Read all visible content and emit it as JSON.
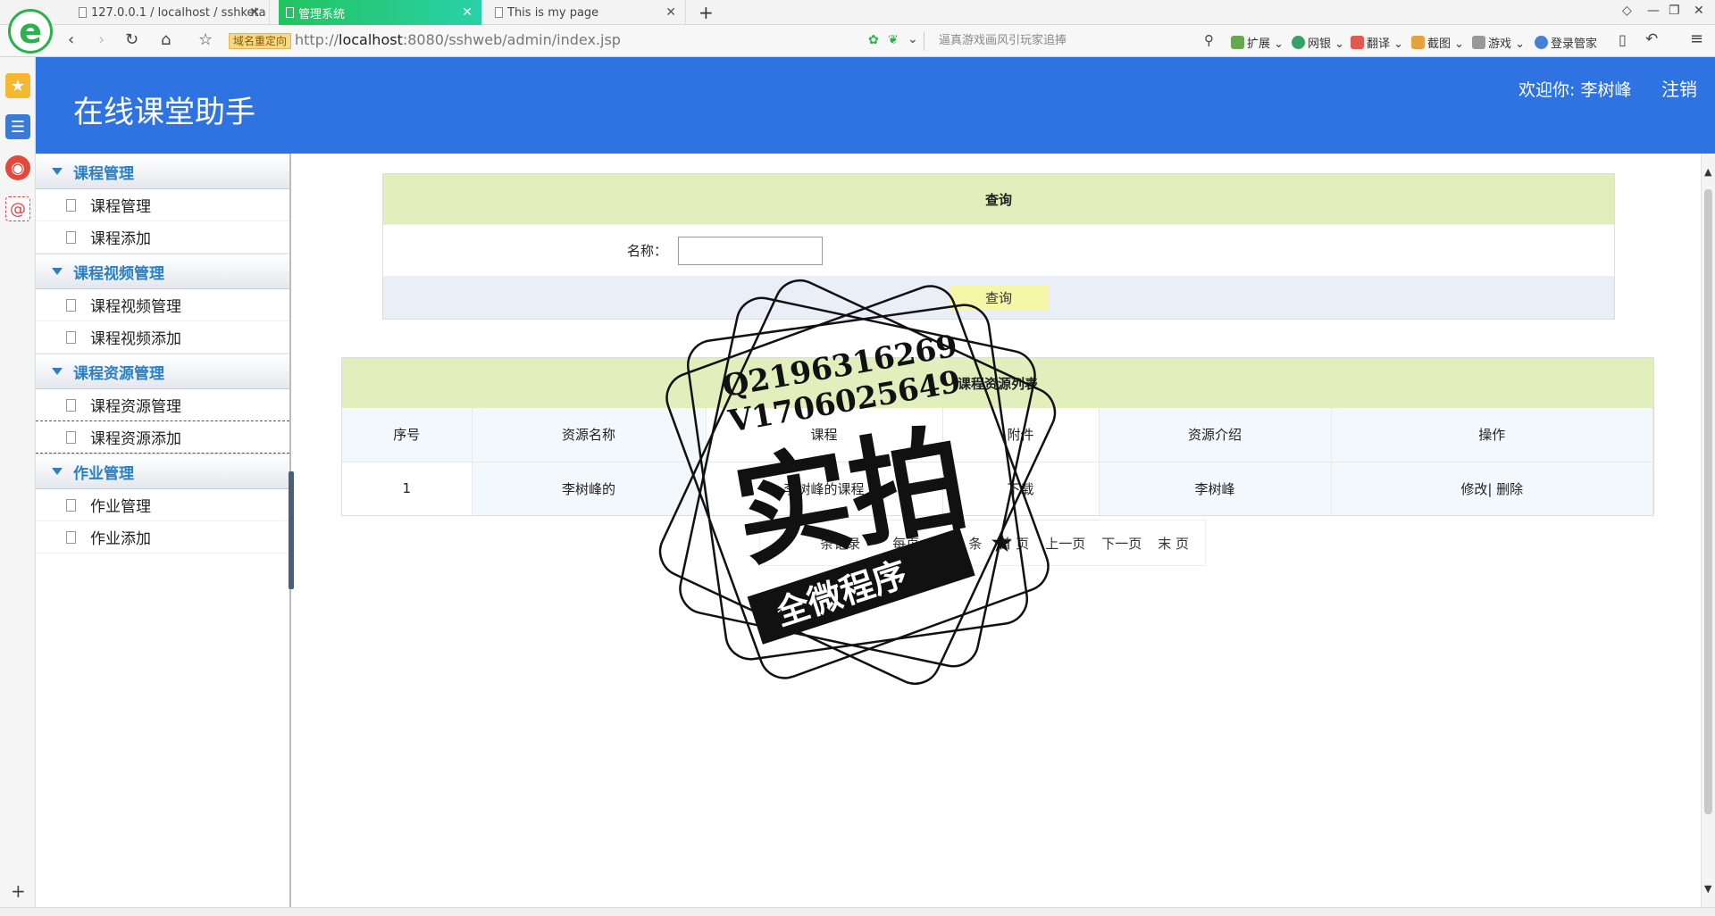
{
  "browser": {
    "tabs": [
      {
        "label": "127.0.0.1 / localhost / sshketa"
      },
      {
        "label": "管理系统"
      },
      {
        "label": "This is my page"
      }
    ],
    "redirect_badge": "域名重定向",
    "url_prefix": "http://",
    "url_host": "localhost",
    "url_rest": ":8080/sshweb/admin/index.jsp",
    "search_placeholder": "逼真游戏画风引玩家追捧",
    "tools": {
      "extend": "扩展",
      "netbank": "网银",
      "translate": "翻译",
      "screenshot": "截图",
      "games": "游戏",
      "login": "登录管家"
    }
  },
  "header": {
    "title": "在线课堂助手",
    "welcome": "欢迎你: 李树峰",
    "logout": "注销"
  },
  "menu": {
    "groups": [
      {
        "title": "课程管理",
        "items": [
          "课程管理",
          "课程添加"
        ]
      },
      {
        "title": "课程视频管理",
        "items": [
          "课程视频管理",
          "课程视频添加"
        ]
      },
      {
        "title": "课程资源管理",
        "items": [
          "课程资源管理",
          "课程资源添加"
        ]
      },
      {
        "title": "作业管理",
        "items": [
          "作业管理",
          "作业添加"
        ]
      }
    ]
  },
  "query": {
    "title": "查询",
    "name_label": "名称：",
    "name_value": "",
    "button": "查询"
  },
  "resources": {
    "title": "课程资源列表",
    "columns": [
      "序号",
      "资源名称",
      "课程",
      "附件",
      "资源介绍",
      "操作"
    ],
    "rows": [
      {
        "index": "1",
        "name": "李树峰的",
        "course": "李树峰的课程",
        "attachment": "下载",
        "intro": "李树峰",
        "edit": "修改",
        "delete": "删除"
      }
    ]
  },
  "pager": {
    "records": "条记录",
    "per_page": "每页",
    "per_page_count": "10",
    "per_page_unit": "条",
    "first": "首 页",
    "prev": "上一页",
    "next": "下一页",
    "last": "末 页"
  },
  "watermark": {
    "line1": "Q2196316269",
    "line2": "V1706025649",
    "big": "实拍",
    "banner": "全微程序"
  }
}
